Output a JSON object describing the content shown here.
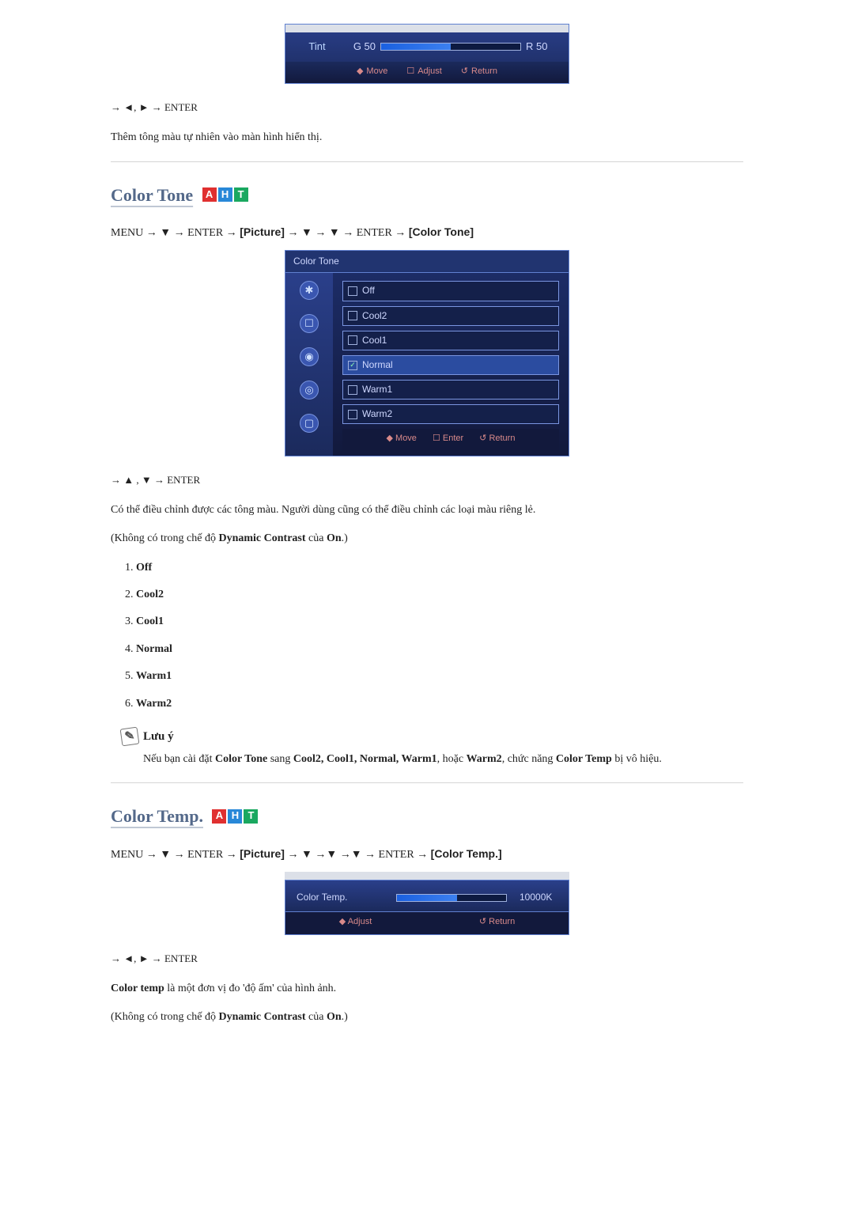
{
  "tint_osd": {
    "label": "Tint",
    "left": "G 50",
    "right": "R 50",
    "footer_move": "Move",
    "footer_adjust": "Adjust",
    "footer_return": "Return"
  },
  "nav1": "→ ◄, ► → ENTER",
  "para1": "Thêm tông màu tự nhiên vào màn hình hiển thị.",
  "section_color_tone": {
    "title": "Color Tone",
    "badge_a": "A",
    "badge_h": "H",
    "badge_t": "T",
    "path_menu": "MENU → ▼ → ENTER → ",
    "path_pic": "[Picture]",
    "path_mid": " → ▼ → ▼ → ENTER → ",
    "path_end": "[Color Tone]",
    "osd_header": "Color Tone",
    "side_icons": [
      "✱",
      "☐",
      "◉",
      "◎",
      "▢"
    ],
    "items": [
      "Off",
      "Cool2",
      "Cool1",
      "Normal",
      "Warm1",
      "Warm2"
    ],
    "footer_move": "Move",
    "footer_enter": "Enter",
    "footer_return": "Return",
    "nav2": "→ ▲ , ▼ → ENTER",
    "desc": "Có thể điều chỉnh được các tông màu. Người dùng cũng có thể điều chỉnh các loại màu riêng lẻ.",
    "cond_pre": "(Không có trong chế độ ",
    "cond_bold": "Dynamic Contrast",
    "cond_mid": " của ",
    "cond_on": "On",
    "cond_end": ".)",
    "list": [
      "Off",
      "Cool2",
      "Cool1",
      "Normal",
      "Warm1",
      "Warm2"
    ],
    "note_label": "Lưu ý",
    "note_pre": "Nếu bạn cài đặt ",
    "note_ct": "Color Tone",
    "note_sang": " sang ",
    "note_opts": "Cool2, Cool1, Normal, Warm1",
    "note_or": ", hoặc ",
    "note_last": "Warm2",
    "note_mid": ", chức năng ",
    "note_ctemp": "Color Temp",
    "note_suf": " bị vô hiệu."
  },
  "section_color_temp": {
    "title": "Color Temp.",
    "badge_a": "A",
    "badge_h": "H",
    "badge_t": "T",
    "path_menu": "MENU → ▼ → ENTER → ",
    "path_pic": "[Picture]",
    "path_mid": " → ▼ →▼ →▼ → ENTER → ",
    "path_end": "[Color Temp.]",
    "osd_label": "Color Temp.",
    "osd_value": "10000K",
    "footer_adjust": "Adjust",
    "footer_return": "Return",
    "nav": "→ ◄, ► → ENTER",
    "desc_pre": "Color temp",
    "desc_rest": " là một đơn vị đo 'độ ấm' của hình ảnh.",
    "cond_pre": "(Không có trong chế độ ",
    "cond_bold": "Dynamic Contrast",
    "cond_mid": " của ",
    "cond_on": "On",
    "cond_end": ".)"
  }
}
